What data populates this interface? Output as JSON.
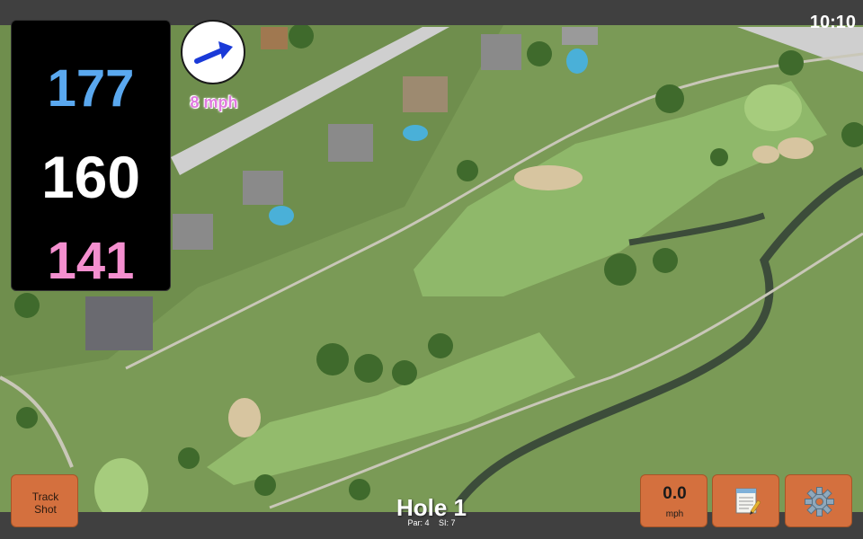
{
  "status": {
    "time": "10:10"
  },
  "distances": {
    "back": "177",
    "middle": "160",
    "front": "141"
  },
  "wind": {
    "speed": "8 mph",
    "direction_icon": "arrow-icon"
  },
  "hole": {
    "title": "Hole 1",
    "par": "Par: 4",
    "si": "SI: 7"
  },
  "buttons": {
    "track_shot_line1": "Track",
    "track_shot_line2": "Shot",
    "speed_value": "0.0",
    "speed_unit": "mph",
    "notes_icon": "notepad-icon",
    "settings_icon": "gear-icon"
  },
  "colors": {
    "back": "#5aa8ef",
    "middle": "#ffffff",
    "front": "#f48fcf",
    "button": "#d4703e",
    "wind_text": "#e07be0"
  }
}
